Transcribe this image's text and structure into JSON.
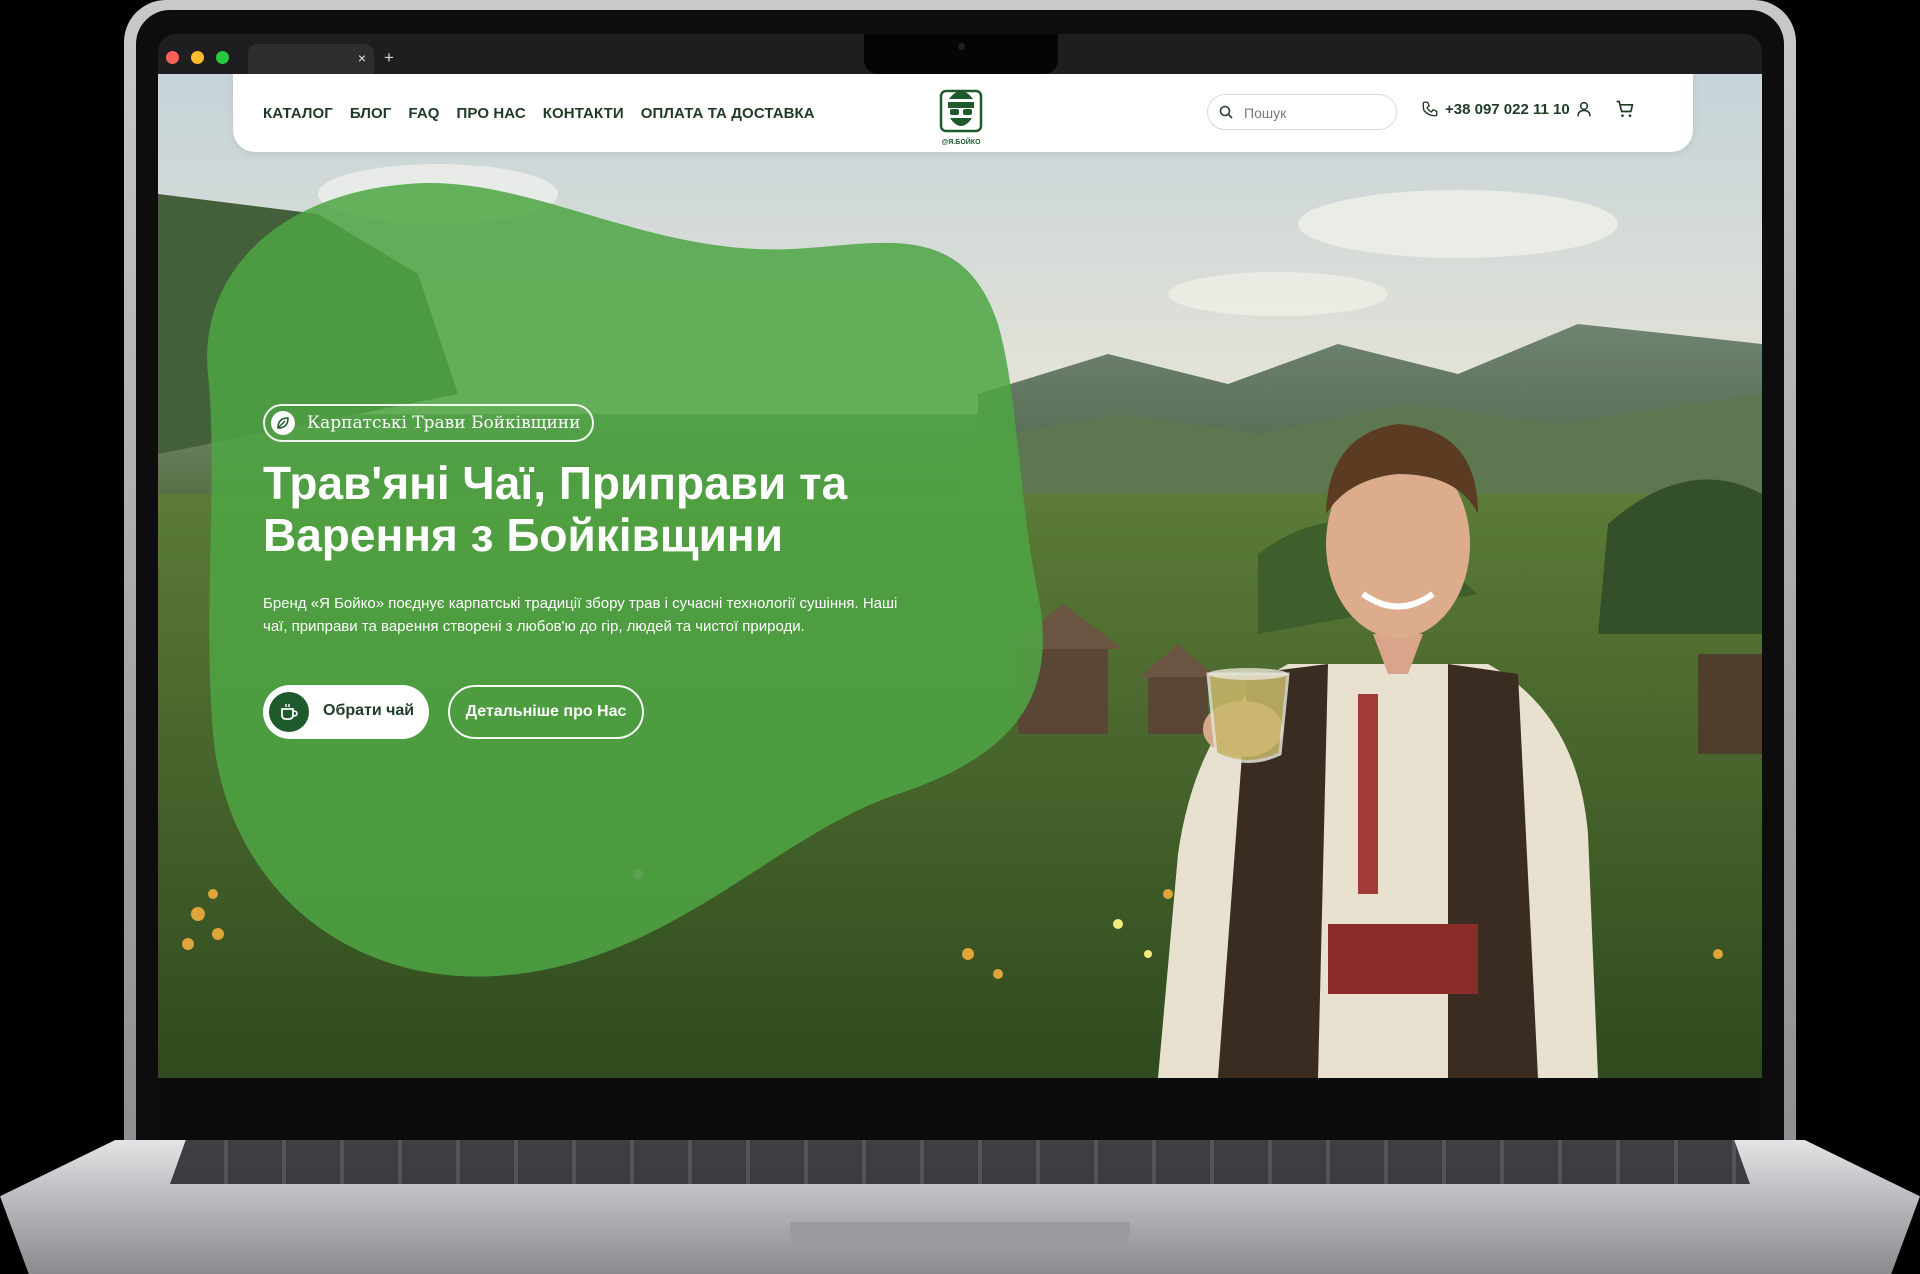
{
  "browser": {
    "tab_close": "×",
    "new_tab": "+"
  },
  "nav": {
    "links": [
      "КАТАЛОГ",
      "БЛОГ",
      "FAQ",
      "ПРО НАС",
      "КОНТАКТИ",
      "ОПЛАТА ТА ДОСТАВКА"
    ],
    "logo_text": "Я БОЙКО",
    "search_placeholder": "Пошук",
    "phone": "+38 097 022 11 10"
  },
  "hero": {
    "badge": "Карпатські Трави Бойківщини",
    "title_line1": "Трав'яні Чаї, Приправи та",
    "title_line2": "Варення з Бойківщини",
    "description": "Бренд «Я Бойко» поєднує карпатські традиції збору трав і сучасні технології сушіння. Наші чаї, приправи та варення створені з любов'ю до гір, людей та чистої природи.",
    "primary_button": "Обрати чай",
    "secondary_button": "Детальніше про Нас"
  },
  "colors": {
    "brand_green": "#1f5a2d",
    "blob_green": "#4ea544",
    "nav_text": "#1f3b26"
  },
  "icons": [
    "search-icon",
    "phone-icon",
    "user-icon",
    "cart-icon",
    "leaf-icon",
    "cup-icon",
    "logo-icon"
  ]
}
